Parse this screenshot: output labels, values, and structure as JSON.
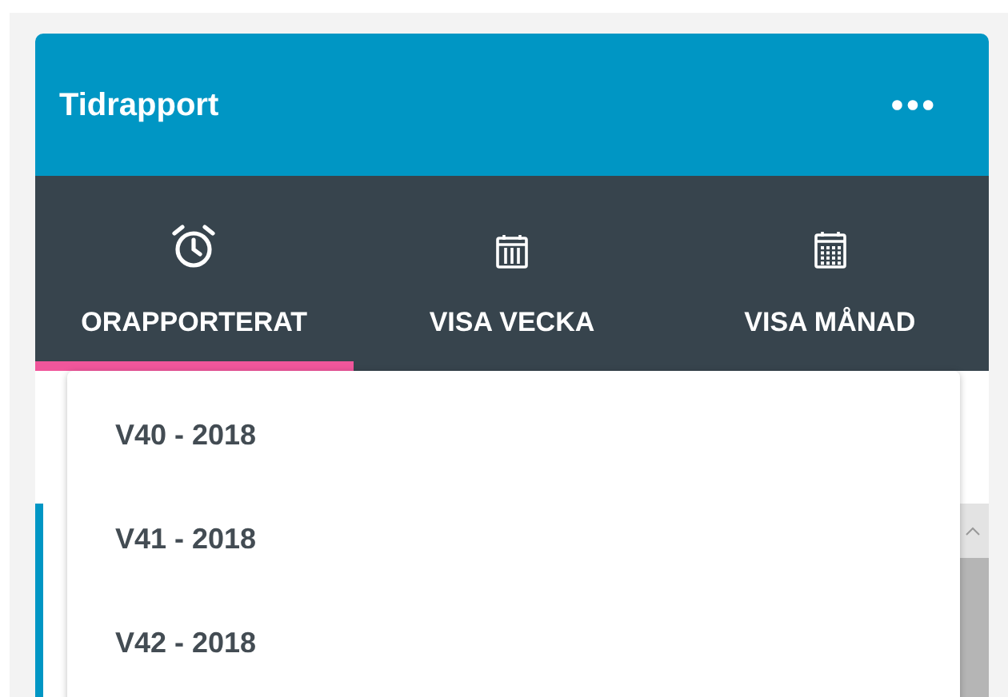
{
  "card": {
    "title": "Tidrapport",
    "menu_icon": "•••"
  },
  "tabs": [
    {
      "label": "ORAPPORTERAT",
      "kind": "clock",
      "selected": true
    },
    {
      "label": "VISA VECKA",
      "kind": "week",
      "selected": false
    },
    {
      "label": "VISA MÅNAD",
      "kind": "month",
      "selected": false
    }
  ],
  "dropdown": {
    "items": [
      {
        "label": "V40 - 2018"
      },
      {
        "label": "V41 - 2018"
      },
      {
        "label": "V42 - 2018"
      }
    ]
  }
}
